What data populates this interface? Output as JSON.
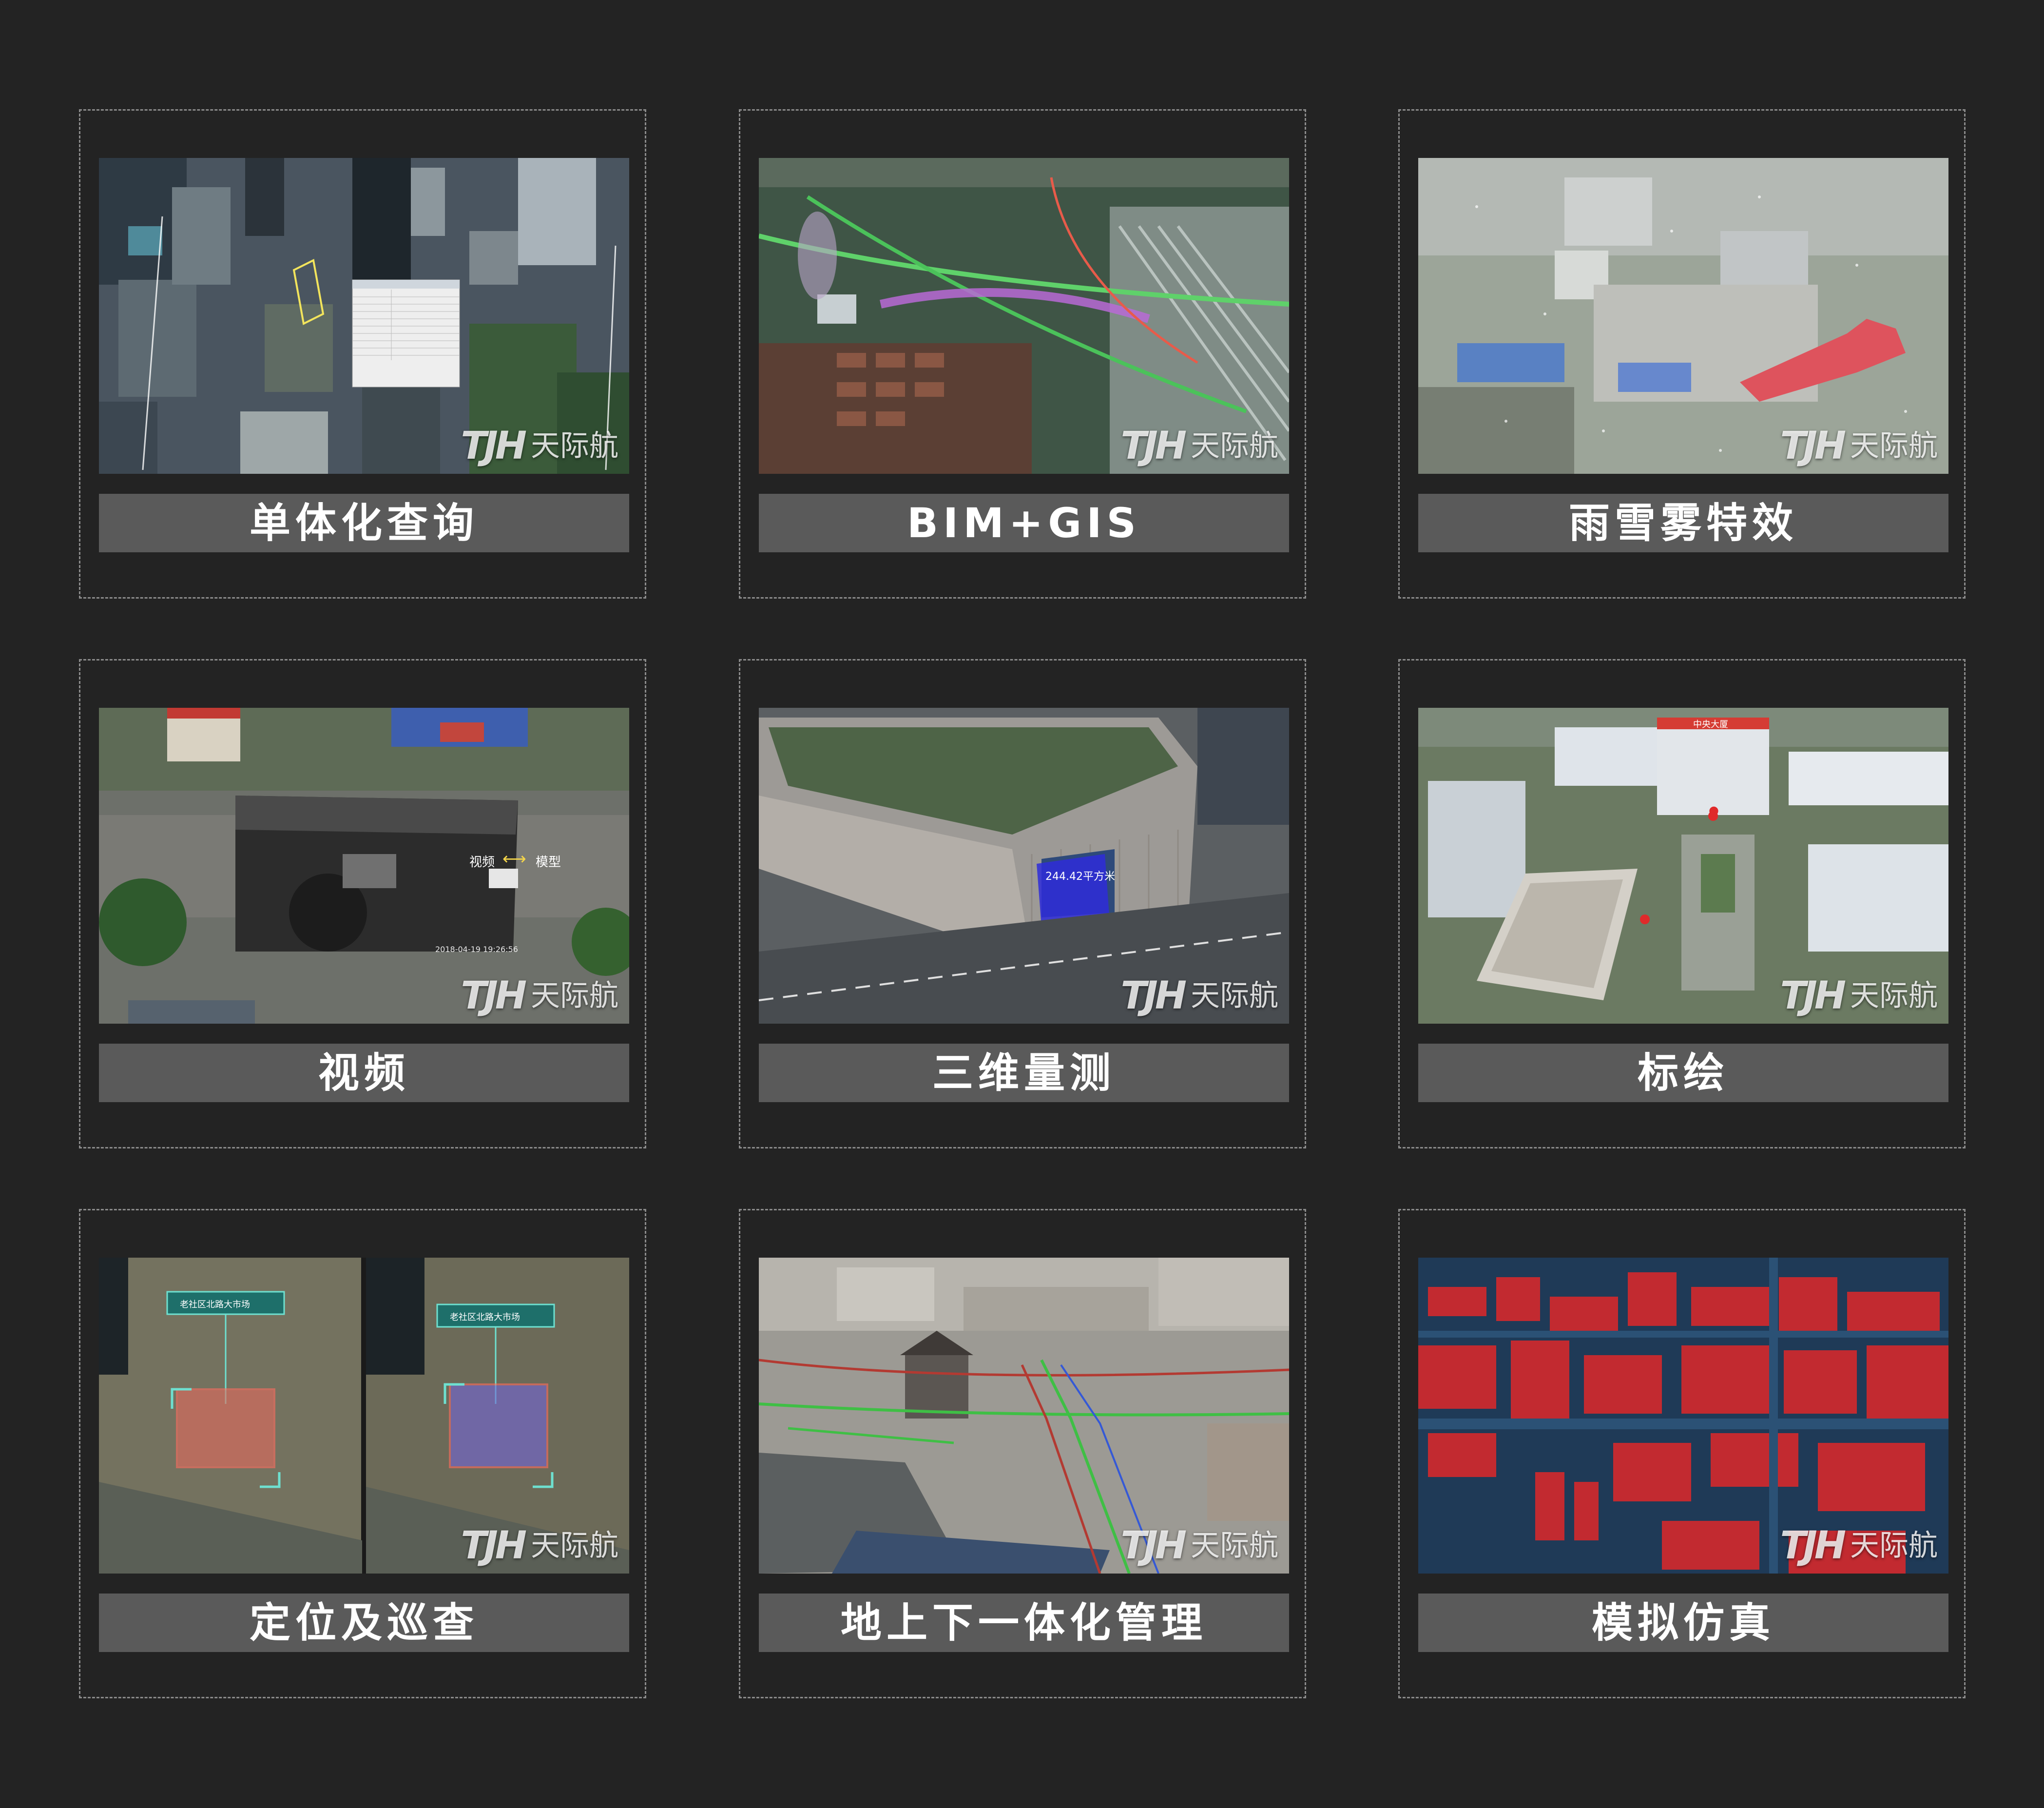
{
  "watermark": {
    "mark": "TJH",
    "text": "天际航"
  },
  "cards": [
    {
      "label": "单体化查询",
      "info_window": {
        "title": "属性",
        "rows": [
          "建筑编号",
          "单体编号",
          "建筑名",
          "建筑类型",
          "所属区域代码",
          "建筑结构",
          "建筑层数",
          "建筑高度",
          "建筑面积",
          "建筑用途"
        ],
        "footer": "删除"
      }
    },
    {
      "label": "BIM+GIS"
    },
    {
      "label": "雨雪雾特效"
    },
    {
      "label": "视频",
      "overlay_label": "视频",
      "overlay_label_right": "模型",
      "timestamp": "2018-04-19 19:26:56"
    },
    {
      "label": "三维量测",
      "measure_text": "244.42平方米"
    },
    {
      "label": "标绘",
      "building_sign": "中央大厦"
    },
    {
      "label": "定位及巡查",
      "map_tag": "老社区北路大市场"
    },
    {
      "label": "地上下一体化管理"
    },
    {
      "label": "模拟仿真"
    }
  ]
}
